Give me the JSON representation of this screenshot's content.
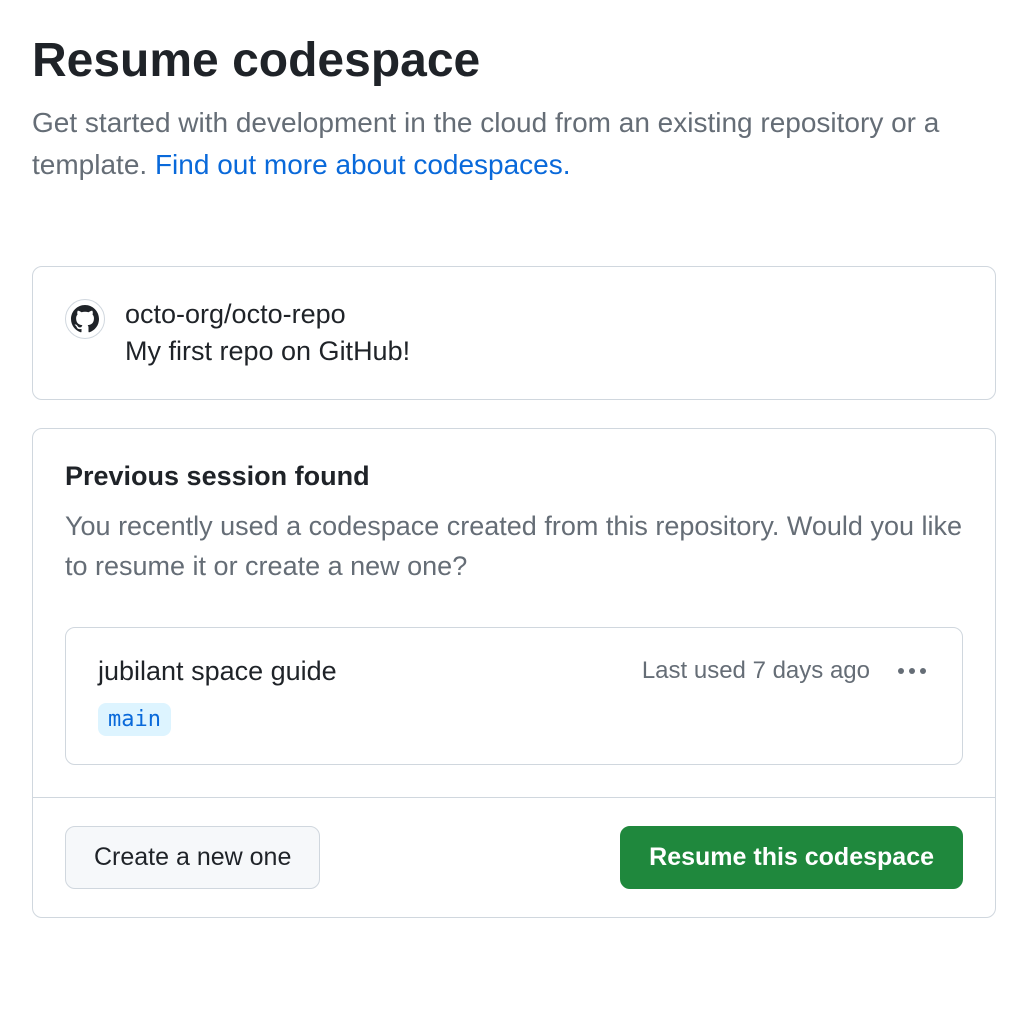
{
  "header": {
    "title": "Resume codespace",
    "subtitle_before_link": "Get started with development in the cloud from an existing repository or a template. ",
    "subtitle_link": "Find out more about codespaces."
  },
  "repo": {
    "name": "octo-org/octo-repo",
    "description": "My first repo on GitHub!"
  },
  "session": {
    "title": "Previous session found",
    "description": "You recently used a codespace created from this repository. Would you like to resume it or create a new one?",
    "codespace": {
      "name": "jubilant space guide",
      "last_used": "Last used 7 days ago",
      "branch": "main"
    }
  },
  "actions": {
    "create_label": "Create a new one",
    "resume_label": "Resume this codespace"
  }
}
